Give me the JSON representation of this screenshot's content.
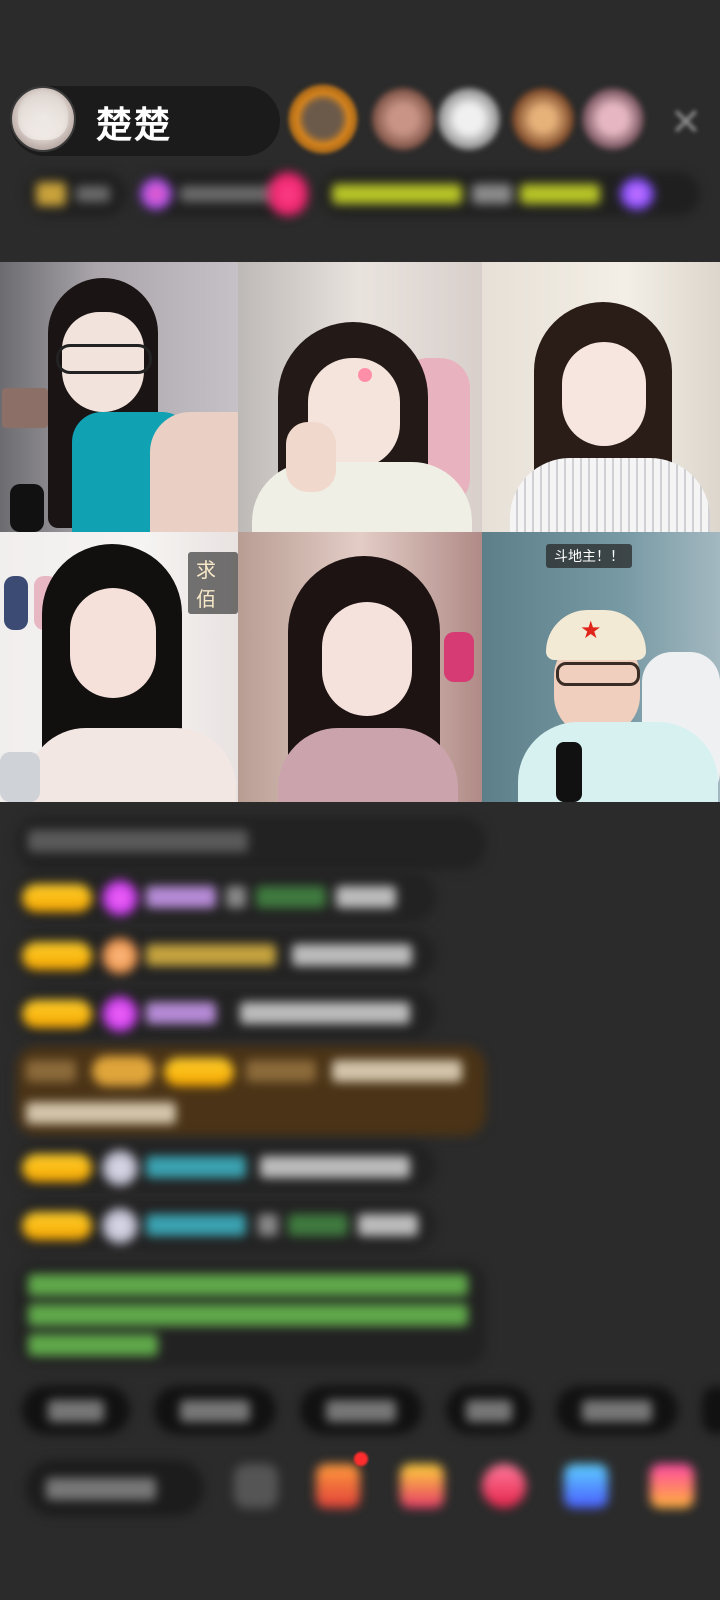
{
  "app": {
    "name": "live-stream-room"
  },
  "host": {
    "name": "楚楚"
  },
  "close_glyph": "✕",
  "video_tiles": [
    {
      "id": 1,
      "overlay": ""
    },
    {
      "id": 2,
      "overlay": ""
    },
    {
      "id": 3,
      "overlay": ""
    },
    {
      "id": 4,
      "overlay": "求佰"
    },
    {
      "id": 5,
      "overlay": ""
    },
    {
      "id": 6,
      "overlay": "斗地主！！"
    }
  ],
  "colors": {
    "accent": "#ffc21a",
    "background": "#2b2b2b",
    "panel": "#222222"
  }
}
